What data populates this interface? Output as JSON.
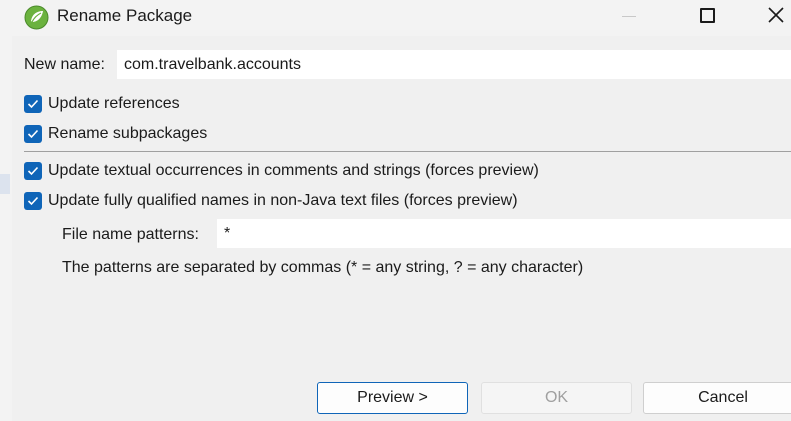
{
  "window": {
    "title": "Rename Package",
    "app_icon": "eclipse-spring-leaf-icon",
    "controls": [
      "minimize-icon",
      "maximize-icon",
      "close-icon"
    ]
  },
  "form": {
    "new_name_label": "New name:",
    "new_name_value": "com.travelbank.accounts",
    "options": [
      {
        "label": "Update references",
        "checked": true
      },
      {
        "label": "Rename subpackages",
        "checked": true
      },
      {
        "label": "Update textual occurrences in comments and strings (forces preview)",
        "checked": true
      },
      {
        "label": "Update fully qualified names in non-Java text files (forces preview)",
        "checked": true
      }
    ],
    "file_patterns_label": "File name patterns:",
    "file_patterns_value": "*",
    "patterns_hint": "The patterns are separated by commas (* = any string, ? = any character)"
  },
  "buttons": {
    "preview": "Preview >",
    "ok": "OK",
    "ok_enabled": false,
    "cancel": "Cancel"
  },
  "colors": {
    "accent": "#0f65b8",
    "background": "#f0f0f0",
    "field": "#ffffff"
  }
}
